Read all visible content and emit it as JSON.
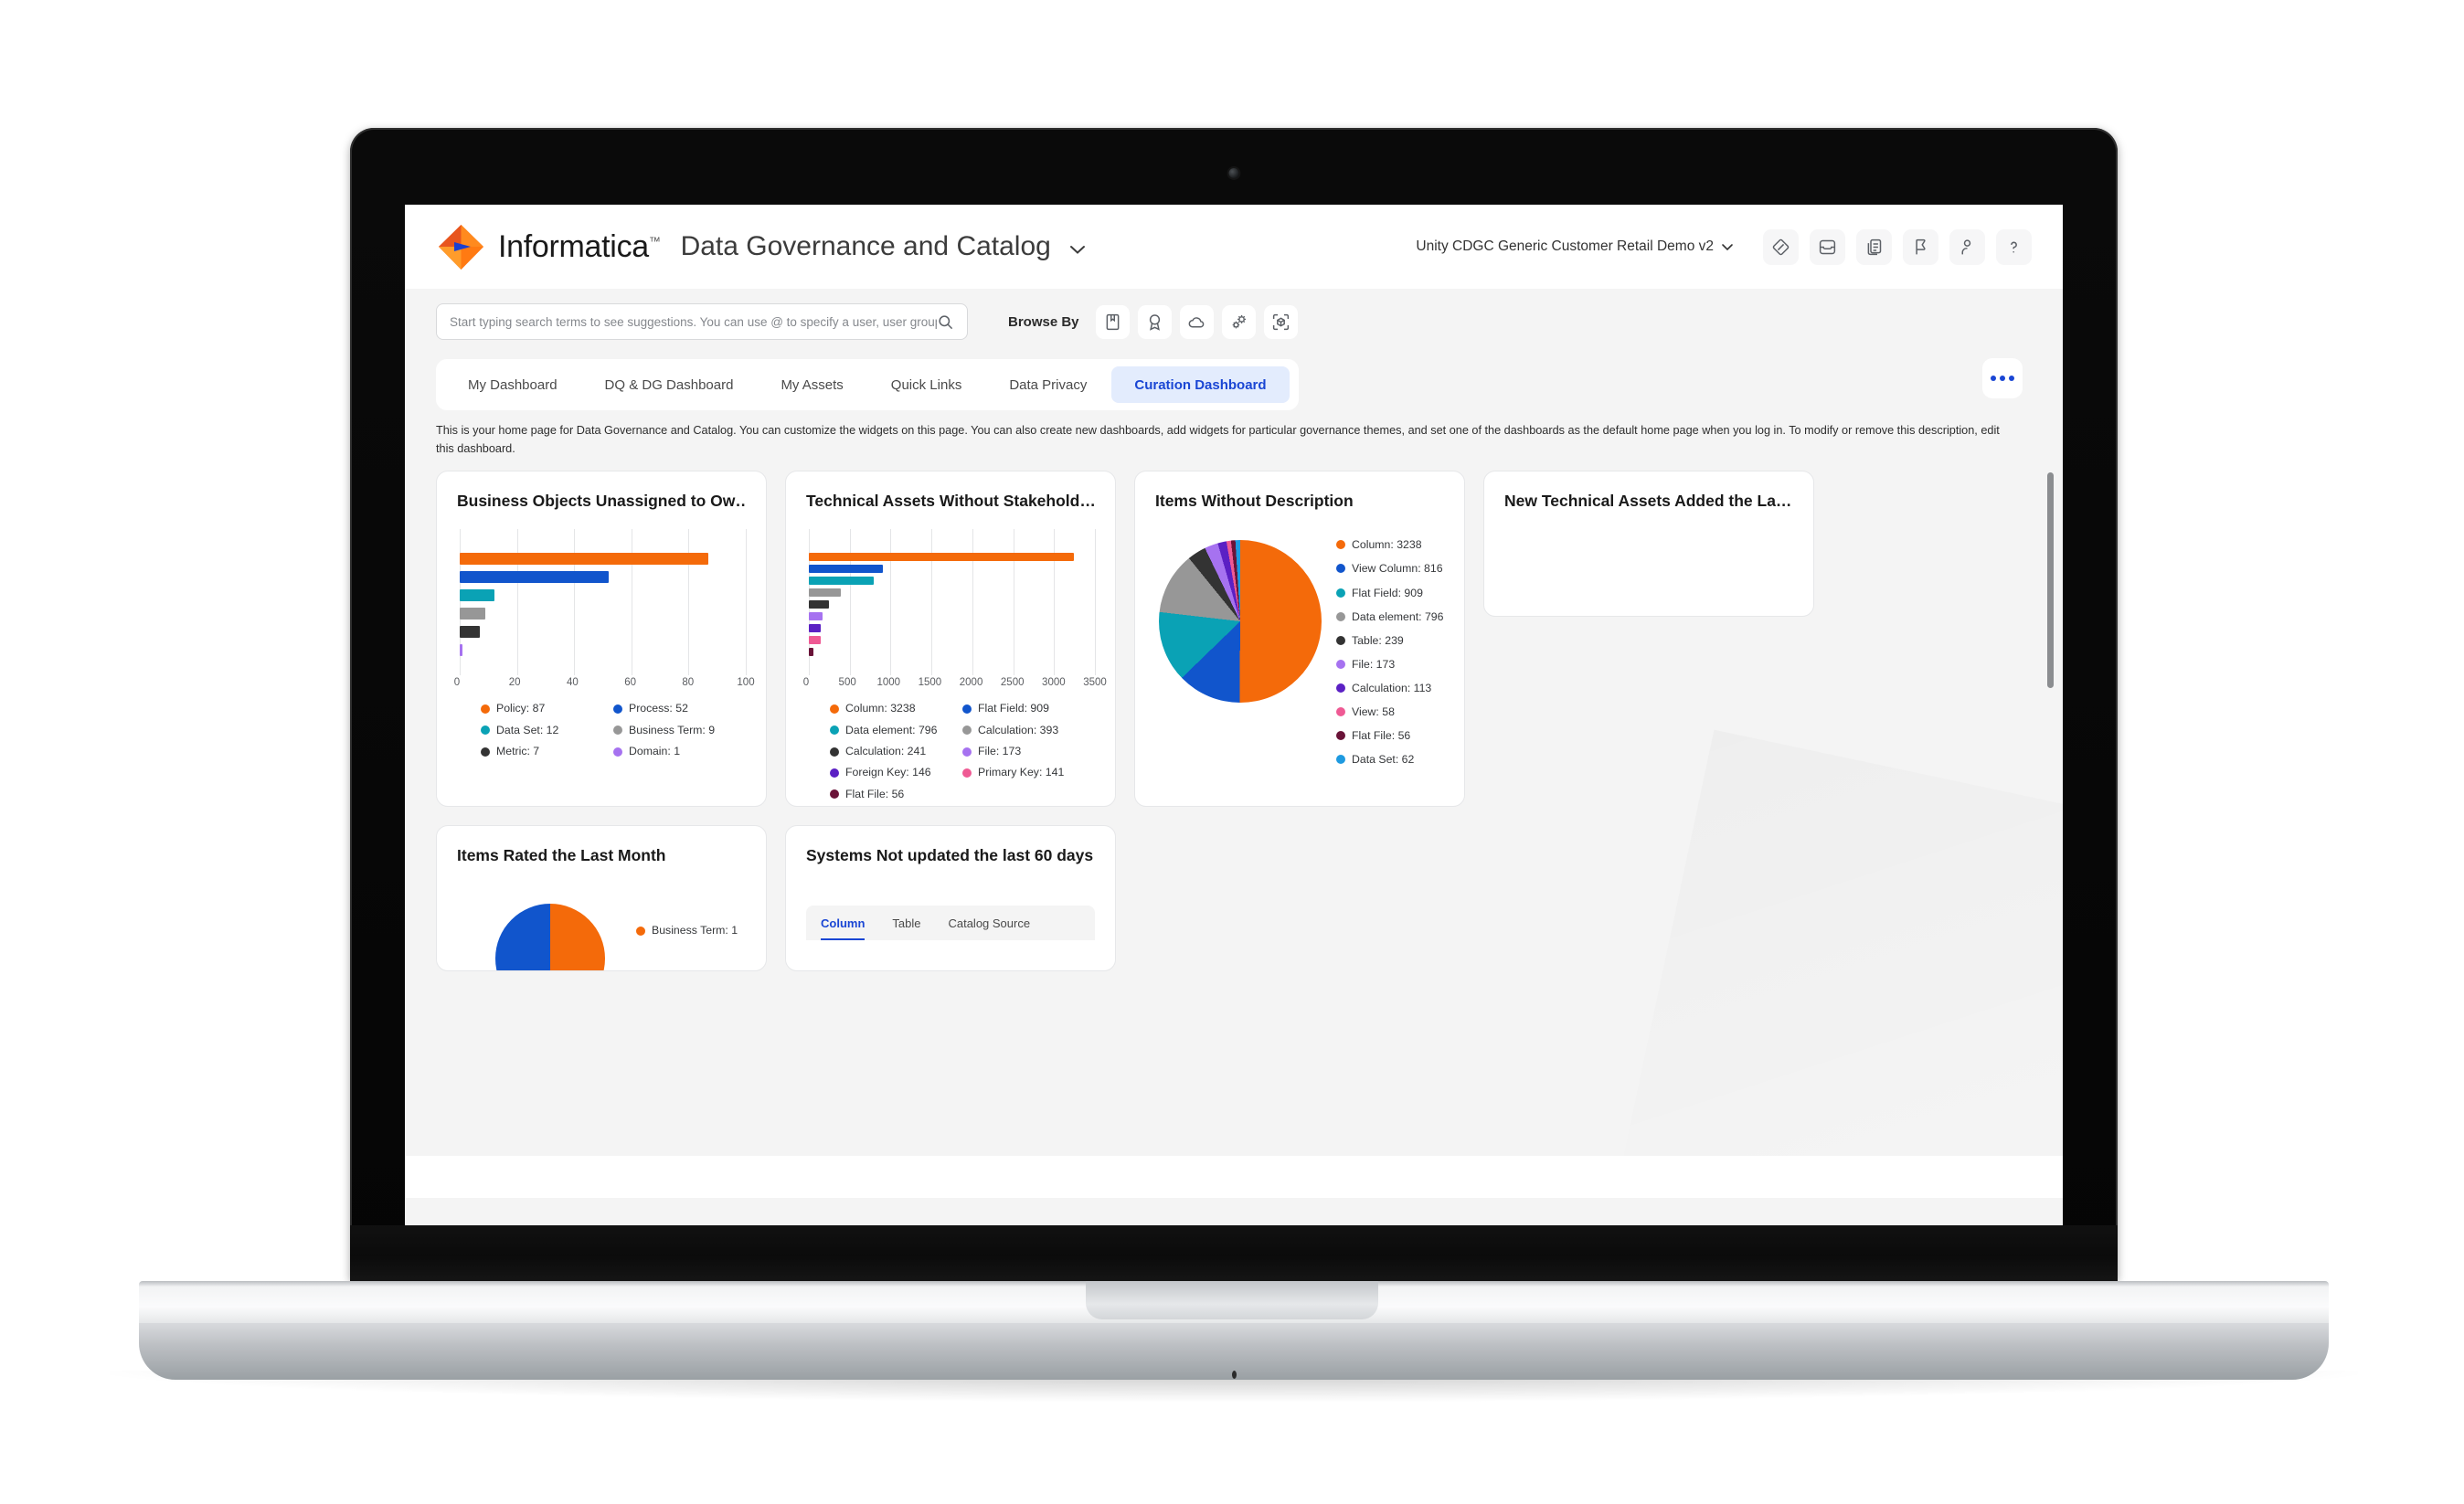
{
  "header": {
    "brand": "Informatica",
    "brand_tm": "™",
    "product": "Data Governance and Catalog",
    "product_chevron": "chevron-down-icon",
    "org": "Unity CDGC Generic Customer Retail Demo v2",
    "org_chevron": "⌄",
    "icons": [
      "tag-icon",
      "inbox-icon",
      "copy-icon",
      "flag-icon",
      "user-icon",
      "help-icon"
    ]
  },
  "search": {
    "placeholder": "Start typing search terms to see suggestions. You can use @ to specify a user, user group or user role.",
    "icon": "search-icon"
  },
  "browse": {
    "label": "Browse By",
    "icons": [
      "glossary-book-icon",
      "award-badge-icon",
      "cloud-icon",
      "gears-icon",
      "asset-scan-icon"
    ]
  },
  "tabs": {
    "items": [
      {
        "label": "My Dashboard",
        "active": false
      },
      {
        "label": "DQ & DG Dashboard",
        "active": false
      },
      {
        "label": "My Assets",
        "active": false
      },
      {
        "label": "Quick Links",
        "active": false
      },
      {
        "label": "Data Privacy",
        "active": false
      },
      {
        "label": "Curation Dashboard",
        "active": true
      }
    ],
    "more_label": "more-options"
  },
  "description": "This is your home page for Data Governance and Catalog. You can customize the widgets on this page. You can also create new dashboards, add widgets for particular governance themes, and set one of the dashboards as the default home page when you log in. To modify or remove this description, edit this dashboard.",
  "widgets": {
    "w1_title": "Business Objects Unassigned to Ow…",
    "w2_title": "Technical Assets Without Stakehold…",
    "w3_title": "Items Without Description",
    "w4_title": "New Technical Assets Added the La…",
    "w5_title": "Items Rated the Last Month",
    "w6_title": "Systems Not updated the last 60 days",
    "w6_subtabs": [
      {
        "label": "Column",
        "active": true
      },
      {
        "label": "Table",
        "active": false
      },
      {
        "label": "Catalog Source",
        "active": false
      }
    ]
  },
  "chart_data": [
    {
      "type": "bar",
      "title": "Business Objects Unassigned to Ow…",
      "orientation": "horizontal",
      "categories": [
        "Policy",
        "Process",
        "Data Set",
        "Business Term",
        "Metric",
        "Domain"
      ],
      "values": [
        87,
        52,
        12,
        9,
        7,
        1
      ],
      "colors": [
        "#f46a0a",
        "#1155cc",
        "#0aa2b5",
        "#979797",
        "#333333",
        "#a672f0"
      ],
      "legend_labels": [
        "Policy: 87",
        "Process: 52",
        "Data Set: 12",
        "Business Term: 9",
        "Metric: 7",
        "Domain: 1"
      ],
      "xlabel": "",
      "ylabel": "",
      "xlim": [
        0,
        100
      ],
      "xticks": [
        0,
        20,
        40,
        60,
        80,
        100
      ],
      "grid": true,
      "legend_position": "bottom"
    },
    {
      "type": "bar",
      "title": "Technical Assets Without Stakehold…",
      "orientation": "horizontal",
      "categories": [
        "Column",
        "Flat Field",
        "Data element",
        "Calculation",
        "Calculation",
        "File",
        "Foreign Key",
        "Primary Key",
        "Flat File"
      ],
      "values": [
        3238,
        909,
        796,
        393,
        241,
        173,
        146,
        141,
        56
      ],
      "colors": [
        "#f46a0a",
        "#1155cc",
        "#0aa2b5",
        "#979797",
        "#333333",
        "#a672f0",
        "#5b20c4",
        "#ef5a94",
        "#6a1338"
      ],
      "legend_labels": [
        "Column: 3238",
        "Flat Field: 909",
        "Data element: 796",
        "Calculation: 393",
        "Calculation: 241",
        "File: 173",
        "Foreign Key: 146",
        "Primary Key: 141",
        "Flat File: 56"
      ],
      "xlabel": "",
      "ylabel": "",
      "xlim": [
        0,
        3500
      ],
      "xticks": [
        0,
        500,
        1000,
        1500,
        2000,
        2500,
        3000,
        3500
      ],
      "grid": true,
      "legend_position": "bottom"
    },
    {
      "type": "pie",
      "title": "Items Without Description",
      "labels": [
        "Column",
        "View Column",
        "Flat Field",
        "Data element",
        "Table",
        "File",
        "Calculation",
        "View",
        "Flat File",
        "Data Set"
      ],
      "values": [
        3238,
        816,
        909,
        796,
        239,
        173,
        113,
        58,
        56,
        62
      ],
      "colors": [
        "#f46a0a",
        "#1155cc",
        "#0aa2b5",
        "#979797",
        "#333333",
        "#a672f0",
        "#5b20c4",
        "#ef5a94",
        "#6a1338",
        "#1e9ae0"
      ],
      "legend_labels": [
        "Column: 3238",
        "View Column: 816",
        "Flat Field: 909",
        "Data element: 796",
        "Table: 239",
        "File: 173",
        "Calculation: 113",
        "View: 58",
        "Flat File: 56",
        "Data Set: 62"
      ],
      "legend_position": "right"
    },
    {
      "type": "pie",
      "title": "Items Rated the Last Month",
      "labels": [
        "Business Term"
      ],
      "values": [
        1
      ],
      "colors": [
        "#f46a0a",
        "#1155cc"
      ],
      "legend_labels": [
        "Business Term: 1"
      ],
      "legend_position": "right"
    }
  ]
}
